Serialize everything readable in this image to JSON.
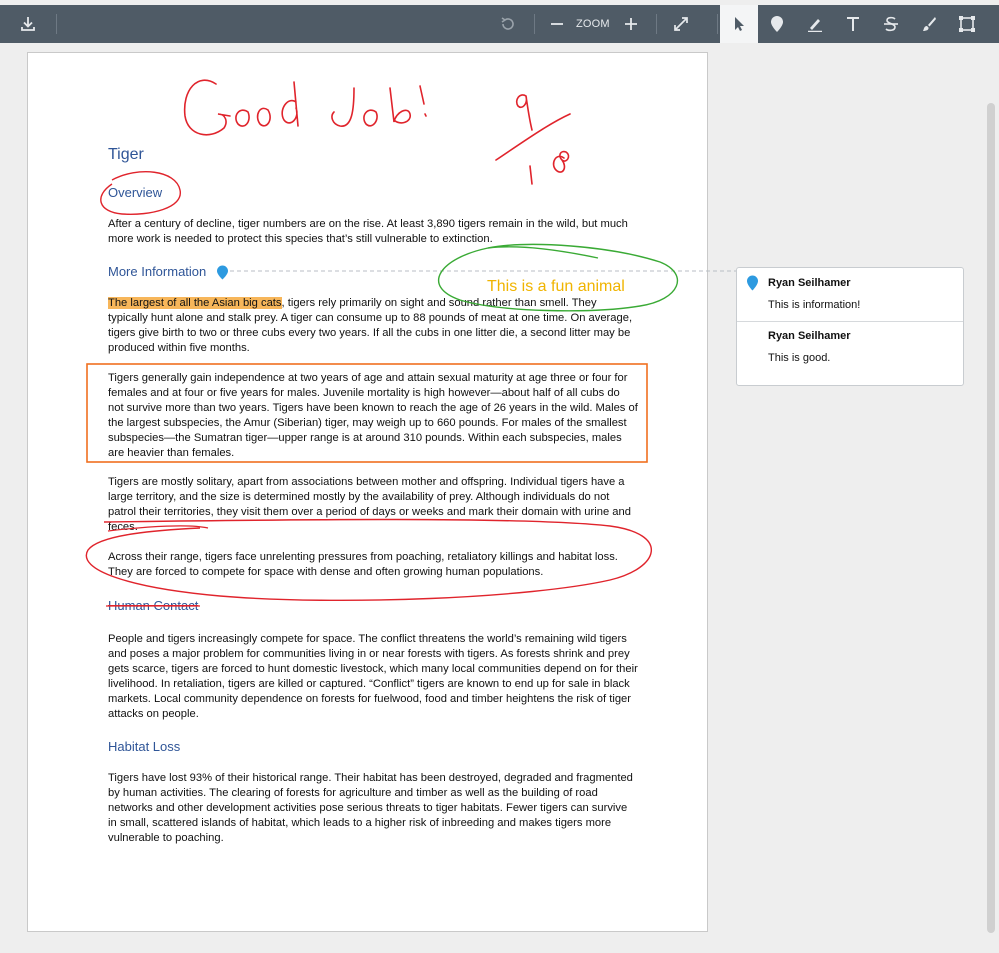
{
  "toolbar": {
    "zoom_label": "ZOOM",
    "icons": [
      "download-icon",
      "rotate-icon",
      "zoom-out-icon",
      "zoom-in-icon",
      "fullscreen-icon",
      "select-pointer-icon",
      "pin-comment-icon",
      "highlighter-icon",
      "text-tool-icon",
      "strikethrough-icon",
      "brush-icon",
      "shape-rectangle-icon"
    ],
    "colors": {
      "bar": "#4f5b66",
      "icon": "#e6e9ec",
      "active_bg": "#f4f5f6"
    }
  },
  "document": {
    "title": "Tiger",
    "h_overview": "Overview",
    "p_overview": "After a century of decline, tiger numbers are on the rise. At least 3,890 tigers remain in the wild, but much more work is needed to protect this species that’s still vulnerable to extinction.",
    "h_more": "More Information",
    "p_more_highlight": "The largest of all the Asian big cats",
    "p_more_rest": ", tigers rely primarily on sight and sound rather than smell. They typically hunt alone and stalk prey. A tiger can consume up to 88 pounds of meat at one time. On average, tigers give birth to two or three cubs every two years. If all the cubs in one litter die, a second litter may be produced within five months.",
    "p_independence": "Tigers generally gain independence at two years of age and attain sexual maturity at age three or four for females and at four or five years for males. Juvenile mortality is high however—about half of all cubs do not survive more than two years. Tigers have been known to reach the age of 26 years in the wild. Males of the largest subspecies, the Amur (Siberian) tiger, may weigh up to 660 pounds. For males of the smallest subspecies—the Sumatran tiger—upper range is at around 310 pounds. Within each subspecies, males are heavier than females.",
    "p_solitary": "Tigers are mostly solitary, apart from associations between mother and offspring. Individual tigers have a large territory, and the size is determined mostly by the availability of prey. Although individuals do not patrol their territories, they visit them over a period of days or weeks and mark their domain with urine and feces.",
    "p_pressures": "Across their range, tigers face unrelenting pressures from poaching, retaliatory killings and habitat loss. They are forced to compete for space with dense and often growing human populations.",
    "h_human": "Human Contact",
    "p_human": "People and tigers increasingly compete for space. The conflict threatens the world’s remaining wild tigers and poses a major problem for communities living in or near forests with tigers. As forests shrink and prey gets scarce, tigers are forced to hunt domestic livestock, which many local communities depend on for their livelihood. In retaliation, tigers are killed or captured. “Conflict” tigers are known to end up for sale in black markets. Local community dependence on forests for fuelwood, food and timber heightens the risk of tiger attacks on people.",
    "h_habitat": "Habitat Loss",
    "p_habitat": "Tigers have lost 93% of their historical range. Their habitat has been destroyed, degraded and fragmented by human activities. The clearing of forests for agriculture and timber as well as the building of road networks and other development activities pose serious threats to tiger habitats. Fewer tigers can survive in small, scattered islands of habitat, which leads to a higher risk of inbreeding and makes tigers more vulnerable to poaching."
  },
  "annotations": {
    "text_note": "This is a fun animal",
    "text_note_color": "#f0b400",
    "ink_red": "#e0242c",
    "ink_green": "#3aaa35",
    "box_orange": "#f07020",
    "highlight_color": "#f7b65a"
  },
  "comments": [
    {
      "author": "Ryan Seilhamer",
      "text": "This is information!"
    },
    {
      "author": "Ryan Seilhamer",
      "text": "This is good."
    }
  ]
}
